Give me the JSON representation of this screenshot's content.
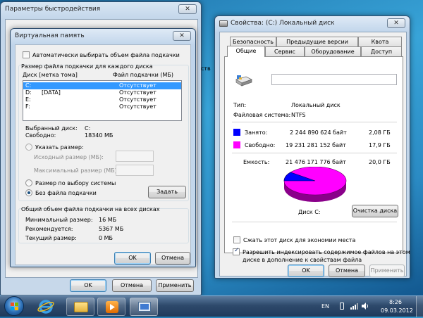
{
  "perf_window": {
    "title": "Параметры быстродействия",
    "close": "✕",
    "ok": "OK",
    "cancel": "Отмена",
    "apply": "Применить"
  },
  "vm_dialog": {
    "title": "Виртуальная память",
    "close": "✕",
    "auto_checkbox_label": "Автоматически выбирать объем файла подкачки",
    "auto_checked": false,
    "group_label": "Размер файла подкачки для каждого диска",
    "col_disk": "Диск [метка тома]",
    "col_pagefile": "Файл подкачки (МБ)",
    "drives": [
      {
        "disk": "C:",
        "label": "",
        "pagefile": "Отсутствует",
        "selected": true
      },
      {
        "disk": "D:",
        "label": "[DATA]",
        "pagefile": "Отсутствует",
        "selected": false
      },
      {
        "disk": "E:",
        "label": "",
        "pagefile": "Отсутствует",
        "selected": false
      },
      {
        "disk": "F:",
        "label": "",
        "pagefile": "Отсутствует",
        "selected": false
      }
    ],
    "selected_disk_label": "Выбранный диск:",
    "selected_disk_value": "C:",
    "free_label": "Свободно:",
    "free_value": "18340 МБ",
    "specify_size_label": "Указать размер:",
    "initial_size_label": "Исходный размер (МБ):",
    "initial_size_value": "",
    "max_size_label": "Максимальный размер (МБ):",
    "max_size_value": "",
    "system_managed_label": "Размер по выбору системы",
    "no_pagefile_label": "Без файла подкачки",
    "set_button": "Задать",
    "total_group_label": "Общий объем файла подкачки на всех дисках",
    "min_label": "Минимальный размер:",
    "min_value": "16 МБ",
    "recommended_label": "Рекомендуется:",
    "recommended_value": "5367 МБ",
    "current_label": "Текущий размер:",
    "current_value": "0 МБ",
    "ok": "OK",
    "cancel": "Отмена"
  },
  "perf_partial_texts": {
    "right_edge_text": "ств",
    "apply_fragment": "ть"
  },
  "disk_props": {
    "title": "Свойства: (C:) Локальный диск",
    "close": "✕",
    "tabs_row1": [
      "Безопасность",
      "Предыдущие версии",
      "Квота"
    ],
    "tabs_row2": [
      "Общие",
      "Сервис",
      "Оборудование",
      "Доступ"
    ],
    "active_tab": "Общие",
    "drive_name_value": "",
    "type_label": "Тип:",
    "type_value": "Локальный диск",
    "fs_label": "Файловая система:",
    "fs_value": "NTFS",
    "used_label": "Занято:",
    "used_bytes": "2 244 890 624 байт",
    "used_gb": "2,08 ГБ",
    "free_label": "Свободно:",
    "free_bytes": "19 231 281 152 байт",
    "free_gb": "17,9 ГБ",
    "capacity_label": "Емкость:",
    "capacity_bytes": "21 476 171 776 байт",
    "capacity_gb": "20,0 ГБ",
    "used_fraction": 0.104,
    "used_color": "#0000ff",
    "free_color": "#ff00ff",
    "disk_caption": "Диск C:",
    "cleanup_button": "Очистка диска",
    "compress_label": "Сжать этот диск для экономии места",
    "compress_checked": false,
    "index_label": "Разрешить индексировать содержимое файлов на этом диске в дополнение к свойствам файла",
    "index_line1": "Разрешить индексировать содержимое файлов на этом",
    "index_line2": "диске в дополнение к свойствам файла",
    "index_checked": true,
    "ok": "OK",
    "cancel": "Отмена",
    "apply": "Применить"
  },
  "taskbar": {
    "lang": "EN",
    "time": "8:26",
    "date": "09.03.2012",
    "icons": [
      "start-orb-icon",
      "internet-explorer-icon",
      "file-explorer-icon",
      "media-player-icon",
      "system-properties-icon"
    ]
  }
}
